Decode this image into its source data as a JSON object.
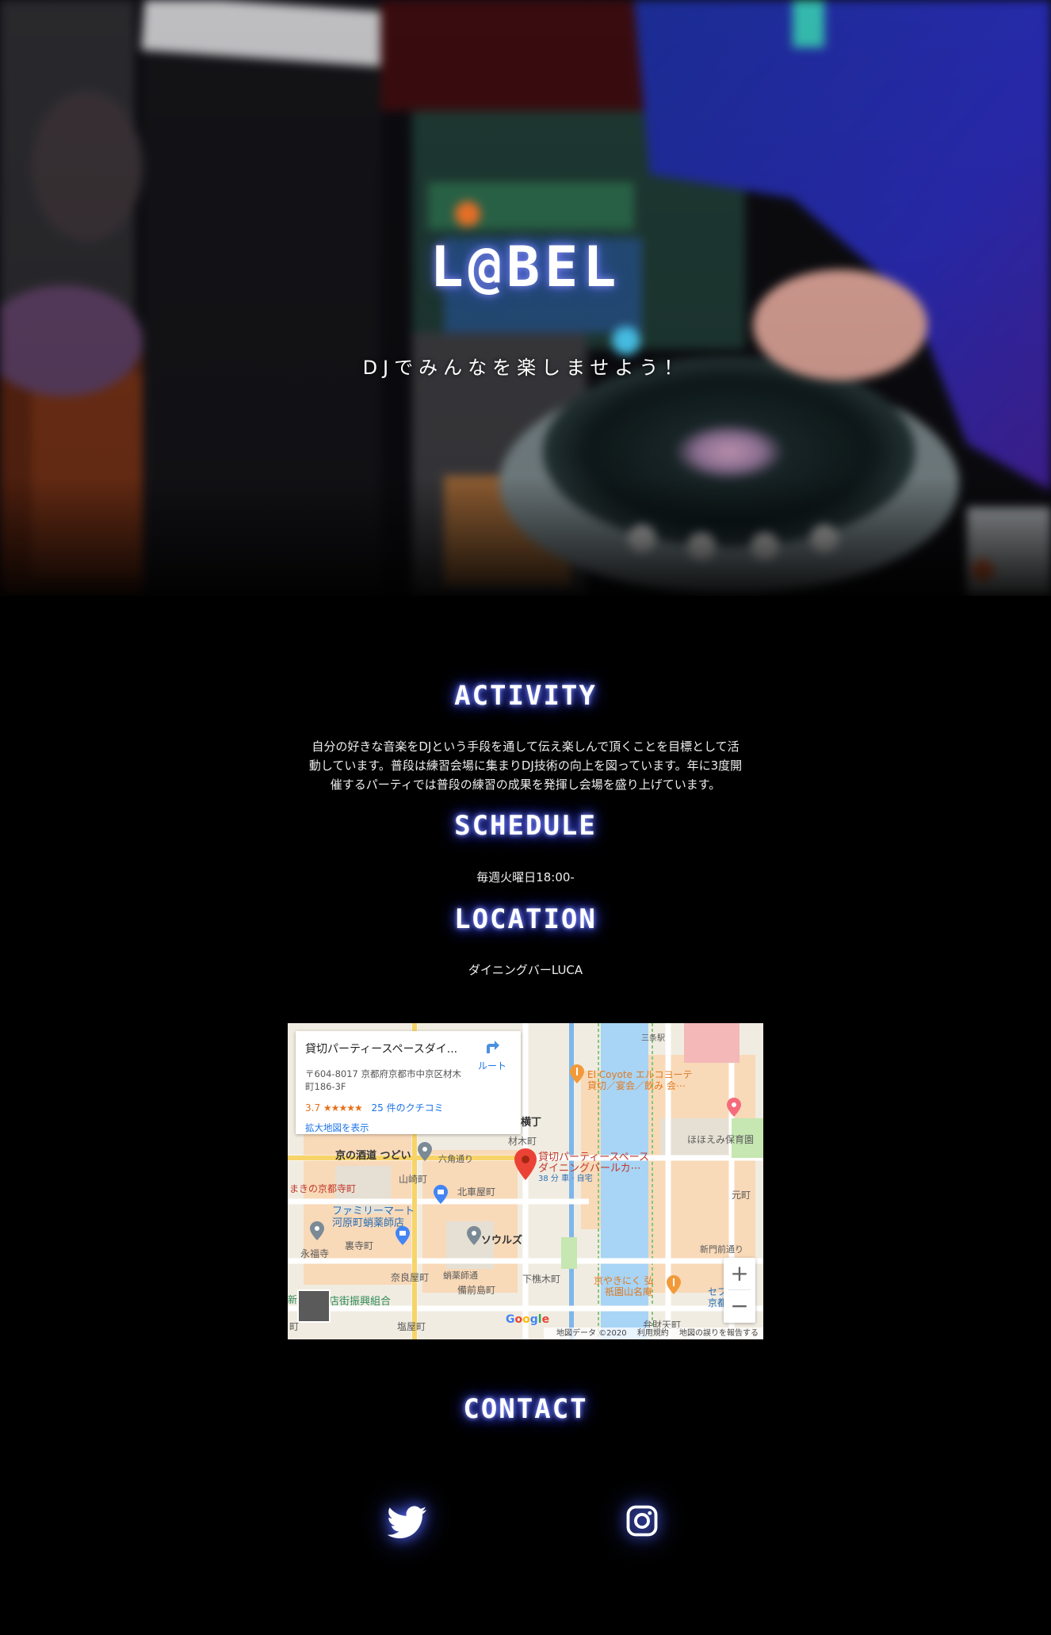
{
  "hero": {
    "title": "L@BEL",
    "subtitle": "DJでみんなを楽しませよう！"
  },
  "activity": {
    "heading": "ACTIVITY",
    "lines": [
      "自分の好きな音楽をDJという手段を通して伝え楽しんで頂くことを目標として活",
      "動しています。普段は練習会場に集まりDJ技術の向上を図っています。年に3度開",
      "催するパーティでは普段の練習の成果を発揮し会場を盛り上げています。"
    ]
  },
  "schedule": {
    "heading": "SCHEDULE",
    "text": "毎週火曜日18:00-"
  },
  "location": {
    "heading": "LOCATION",
    "text": "ダイニングバーLUCA"
  },
  "map": {
    "card_title": "貸切パーティースペースダイ...",
    "route_label": "ルート",
    "address_line1": "〒604-8017 京都府京都市中京区材木",
    "address_line2": "町186-3F",
    "rating": "3.7",
    "stars": "★★★★★",
    "reviews_label": "25 件のクチコミ",
    "larger_map_label": "拡大地図を表示",
    "zoom_in": "+",
    "zoom_out": "−",
    "google_logo": "Google",
    "footer": [
      "地図データ ©2020",
      "利用規約",
      "地図の誤りを報告する"
    ],
    "labels": [
      "三条駅",
      "El Coyote エルコヨーテ",
      "貸切／宴会／飲み 会⋯",
      "ほほえみ保育園",
      "横丁",
      "材木町",
      "京の酒道 つどい",
      "六角通り",
      "貸切パーティースペース",
      "ダイニングバールカ⋯",
      "38 分 車 · 自宅",
      "山崎町",
      "北車屋町",
      "元町",
      "まきの京都寺町",
      "ファミリーマート",
      "河原町蛸薬師店",
      "ソウルズ",
      "新門前通り",
      "永福寺",
      "裏寺町",
      "奈良屋町",
      "蛸薬師通",
      "下樵木町",
      "京やきにく 弘",
      "祇園山名庵",
      "セブ",
      "京都",
      "備前島町",
      "新",
      "店街振興組合",
      "町",
      "塩屋町",
      "弁財天町"
    ]
  },
  "contact": {
    "heading": "CONTACT"
  }
}
